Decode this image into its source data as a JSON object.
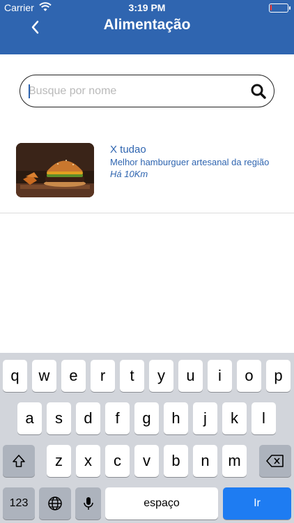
{
  "status_bar": {
    "carrier": "Carrier",
    "time": "3:19 PM",
    "battery_level": 0.1
  },
  "header": {
    "title": "Alimentação",
    "accent_color": "#2f65b0"
  },
  "search": {
    "placeholder": "Busque por nome",
    "value": ""
  },
  "results": [
    {
      "name": "X tudao",
      "description": "Melhor hamburguer artesanal da região",
      "distance": "Há 10Km"
    }
  ],
  "keyboard": {
    "row1": [
      "q",
      "w",
      "e",
      "r",
      "t",
      "y",
      "u",
      "i",
      "o",
      "p"
    ],
    "row2": [
      "a",
      "s",
      "d",
      "f",
      "g",
      "h",
      "j",
      "k",
      "l"
    ],
    "row3": [
      "z",
      "x",
      "c",
      "v",
      "b",
      "n",
      "m"
    ],
    "numbers_label": "123",
    "space_label": "espaço",
    "return_label": "Ir"
  }
}
